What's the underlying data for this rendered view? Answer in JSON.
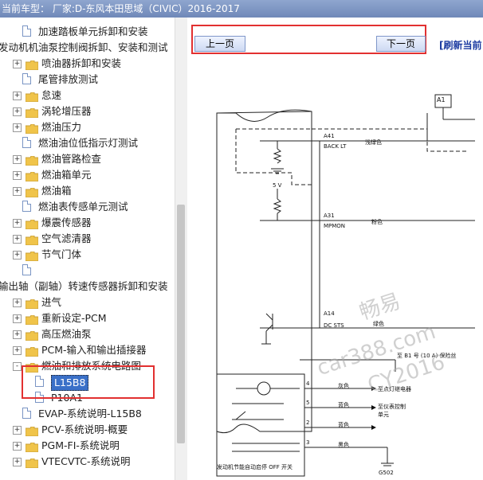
{
  "title": "当前车型： 厂家:D-东风本田思域（CIVIC）2016-2017",
  "tree": [
    {
      "label": "加速踏板单元拆卸和安装",
      "icon": "doc",
      "level": 2,
      "expander": ""
    },
    {
      "label": "发动机机油泵控制阀拆卸、安装和测试",
      "icon": "none",
      "level": 0,
      "expander": ""
    },
    {
      "label": "喷油器拆卸和安装",
      "icon": "folder",
      "level": 1,
      "expander": "+"
    },
    {
      "label": "尾管排放测试",
      "icon": "doc",
      "level": 2,
      "expander": ""
    },
    {
      "label": "怠速",
      "icon": "folder",
      "level": 1,
      "expander": "+"
    },
    {
      "label": "涡轮增压器",
      "icon": "folder",
      "level": 1,
      "expander": "+"
    },
    {
      "label": "燃油压力",
      "icon": "folder",
      "level": 1,
      "expander": "+"
    },
    {
      "label": "燃油油位低指示灯测试",
      "icon": "doc",
      "level": 2,
      "expander": ""
    },
    {
      "label": "燃油管路检查",
      "icon": "folder",
      "level": 1,
      "expander": "+"
    },
    {
      "label": "燃油箱单元",
      "icon": "folder",
      "level": 1,
      "expander": "+"
    },
    {
      "label": "燃油箱",
      "icon": "folder",
      "level": 1,
      "expander": "+"
    },
    {
      "label": "燃油表传感单元测试",
      "icon": "doc",
      "level": 2,
      "expander": ""
    },
    {
      "label": "爆震传感器",
      "icon": "folder",
      "level": 1,
      "expander": "+"
    },
    {
      "label": "空气滤清器",
      "icon": "folder",
      "level": 1,
      "expander": "+"
    },
    {
      "label": "节气门体",
      "icon": "folder",
      "level": 1,
      "expander": "+"
    },
    {
      "label": "",
      "icon": "doc",
      "level": 2,
      "expander": ""
    },
    {
      "label": "输出轴（副轴）转速传感器拆卸和安装",
      "icon": "none",
      "level": 0,
      "expander": ""
    },
    {
      "label": "进气",
      "icon": "folder",
      "level": 1,
      "expander": "+"
    },
    {
      "label": "重新设定-PCM",
      "icon": "folder",
      "level": 1,
      "expander": "+"
    },
    {
      "label": "高压燃油泵",
      "icon": "folder",
      "level": 1,
      "expander": "+"
    },
    {
      "label": "PCM-输入和输出插接器",
      "icon": "folder",
      "level": 1,
      "expander": "+"
    },
    {
      "label": "燃油和排放系统电路图",
      "icon": "folder",
      "level": 1,
      "expander": "-"
    },
    {
      "label": "L15B8",
      "icon": "doc",
      "level": 3,
      "expander": "",
      "selected": true
    },
    {
      "label": "P10A1",
      "icon": "doc",
      "level": 3,
      "expander": ""
    },
    {
      "label": "EVAP-系统说明-L15B8",
      "icon": "doc",
      "level": 2,
      "expander": ""
    },
    {
      "label": "PCV-系统说明-概要",
      "icon": "folder",
      "level": 1,
      "expander": "+"
    },
    {
      "label": "PGM-FI-系统说明",
      "icon": "folder",
      "level": 1,
      "expander": "+"
    },
    {
      "label": "VTECVTC-系统说明",
      "icon": "folder",
      "level": 1,
      "expander": "+"
    }
  ],
  "nav": {
    "prev": "上一页",
    "next": "下一页",
    "refresh": "[刷新当前"
  },
  "diagram": {
    "a1": "A1",
    "pin_a41": "A41",
    "sig_a41": "BACK LT",
    "wire_a41": "浅绿色",
    "volt": "5 V",
    "pin_a31": "A31",
    "sig_a31": "MPMON",
    "wire_a31": "粉色",
    "pin_a14": "A14",
    "sig_a14": "DC STS",
    "wire_a14": "绿色",
    "fuse": "至 B1 号 (10 A) 保险丝",
    "p4": "4",
    "w4": "灰色",
    "d4": "至点灯继电器",
    "p5": "5",
    "w5": "蓝色",
    "d5": "至仪表控制单元",
    "p2": "2",
    "w2": "蓝色",
    "p3": "3",
    "w3": "黑色",
    "switch": "发动机节能自动启停 OFF 开关",
    "ground": "G502"
  },
  "watermark": {
    "line1": "畅易",
    "line2": "car388.com",
    "line3": "CY2016"
  }
}
